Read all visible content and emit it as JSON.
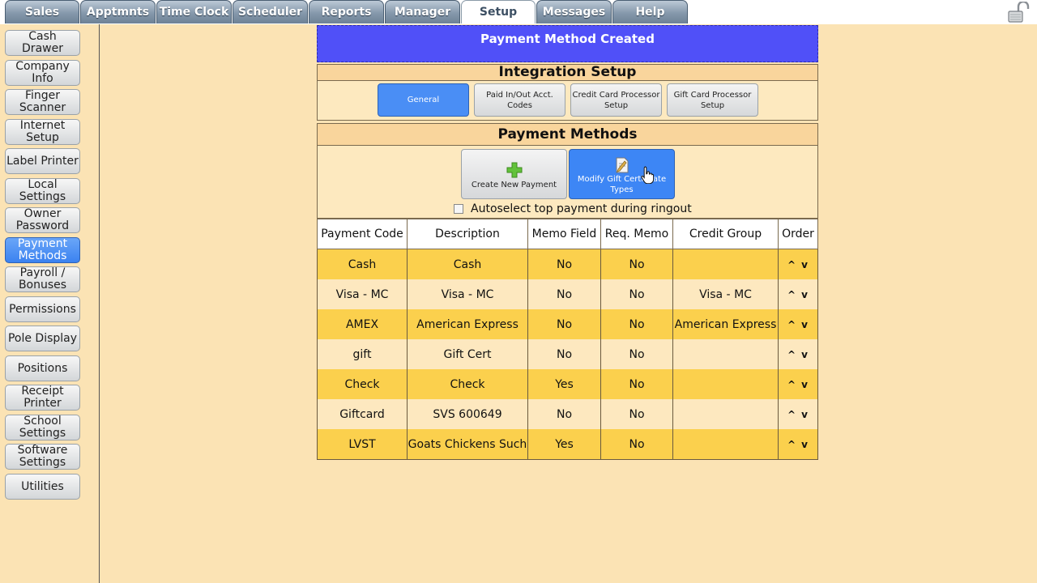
{
  "tabs": [
    "Sales",
    "Apptmnts",
    "Time Clock",
    "Scheduler",
    "Reports",
    "Manager",
    "Setup",
    "Messages",
    "Help"
  ],
  "active_tab": "Setup",
  "sidebar": {
    "items": [
      {
        "label": "Cash Drawer"
      },
      {
        "label": "Company Info"
      },
      {
        "label": "Finger Scanner"
      },
      {
        "label": "Internet Setup"
      },
      {
        "label": "Label Printer"
      },
      {
        "label": "Local Settings"
      },
      {
        "label": "Owner Password"
      },
      {
        "label": "Payment Methods"
      },
      {
        "label": "Payroll / Bonuses"
      },
      {
        "label": "Permissions"
      },
      {
        "label": "Pole Display"
      },
      {
        "label": "Positions"
      },
      {
        "label": "Receipt Printer"
      },
      {
        "label": "School Settings"
      },
      {
        "label": "Software Settings"
      },
      {
        "label": "Utilities"
      }
    ],
    "active": "Payment Methods"
  },
  "banner": "Payment Method Created",
  "integration": {
    "title": "Integration Setup",
    "buttons": [
      "General",
      "Paid In/Out Acct. Codes",
      "Credit Card Processor Setup",
      "Gift Card Processor Setup"
    ],
    "active": "General"
  },
  "payment_methods": {
    "title": "Payment Methods",
    "create_label": "Create New Payment",
    "modify_label": "Modify Gift Certificate Types",
    "autoselect_label": "Autoselect top payment during ringout",
    "columns": [
      "Payment Code",
      "Description",
      "Memo Field",
      "Req. Memo",
      "Credit Group",
      "Order"
    ],
    "rows": [
      [
        "Cash",
        "Cash",
        "No",
        "No",
        ""
      ],
      [
        "Visa - MC",
        "Visa - MC",
        "No",
        "No",
        "Visa - MC"
      ],
      [
        "AMEX",
        "American Express",
        "No",
        "No",
        "American Express"
      ],
      [
        "gift",
        "Gift Cert",
        "No",
        "No",
        ""
      ],
      [
        "Check",
        "Check",
        "Yes",
        "No",
        ""
      ],
      [
        "Giftcard",
        "SVS 600649",
        "No",
        "No",
        ""
      ],
      [
        "LVST",
        "Goats Chickens Such",
        "Yes",
        "No",
        ""
      ]
    ],
    "order_up": "^",
    "order_down": "v"
  },
  "colors": {
    "banner": "#5050f8",
    "accent": "#3d86f5",
    "row_odd": "#fbd04d",
    "row_even": "#fde8bf",
    "background": "#fbe3b4"
  }
}
